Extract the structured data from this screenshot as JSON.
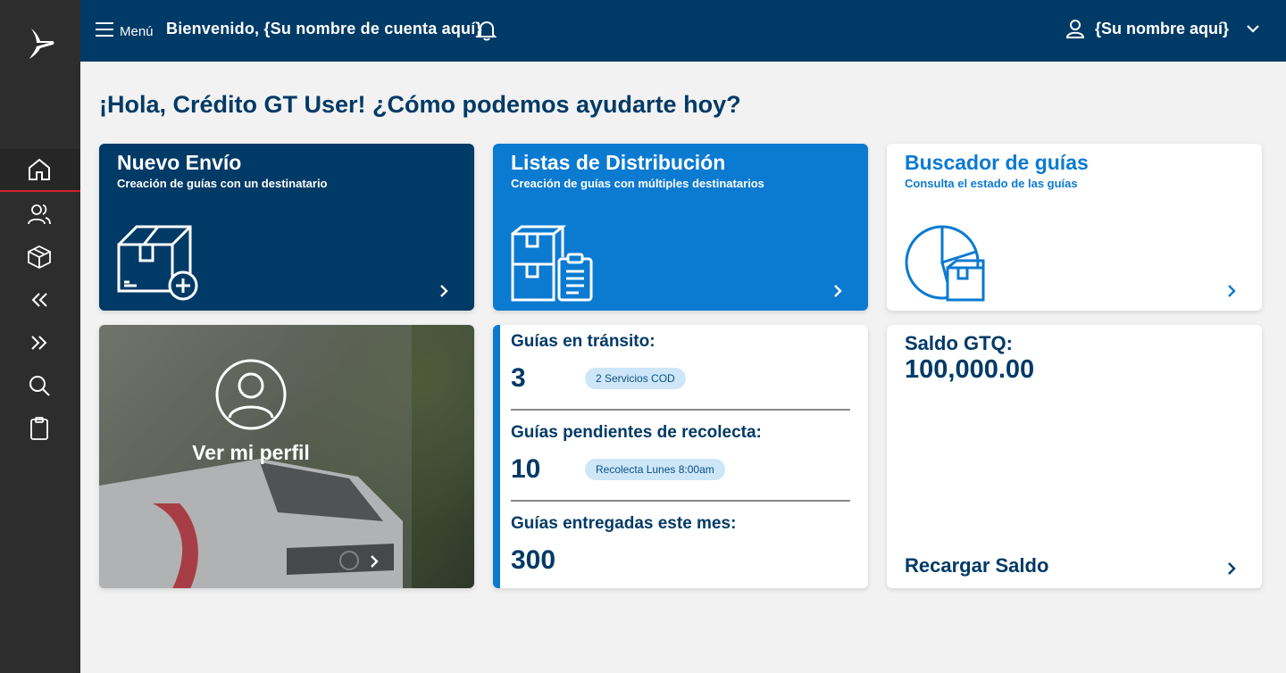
{
  "topbar": {
    "menu_label": "Menú",
    "welcome": "Bienvenido, {Su nombre de cuenta aquí}",
    "user_name": "{Su nombre aquí}"
  },
  "greeting": "¡Hola, Crédito GT User! ¿Cómo podemos ayudarte hoy?",
  "cards": {
    "nuevo_envio": {
      "title": "Nuevo Envío",
      "subtitle": "Creación de guías con un  destinatario"
    },
    "listas": {
      "title": "Listas de Distribución",
      "subtitle": "Creación de guías con múltiples  destinatarios"
    },
    "buscador": {
      "title": "Buscador de guías",
      "subtitle": "Consulta el estado de las guías"
    },
    "perfil": {
      "label": "Ver mi perfil"
    },
    "stats": {
      "transit_label": "Guías en tránsito:",
      "transit_value": "3",
      "transit_pill": "2 Servicios COD",
      "pending_label": "Guías pendientes de recolecta:",
      "pending_value": "10",
      "pending_pill": "Recolecta Lunes 8:00am",
      "delivered_label": "Guías entregadas este mes:",
      "delivered_value": "300"
    },
    "saldo": {
      "label": "Saldo GTQ:",
      "value": "100,000.00",
      "action": "Recargar Saldo"
    }
  },
  "colors": {
    "navy": "#003a66",
    "blue": "#0b7ad1",
    "sidebar": "#2d2d2d",
    "active_indicator": "#d6202a"
  }
}
